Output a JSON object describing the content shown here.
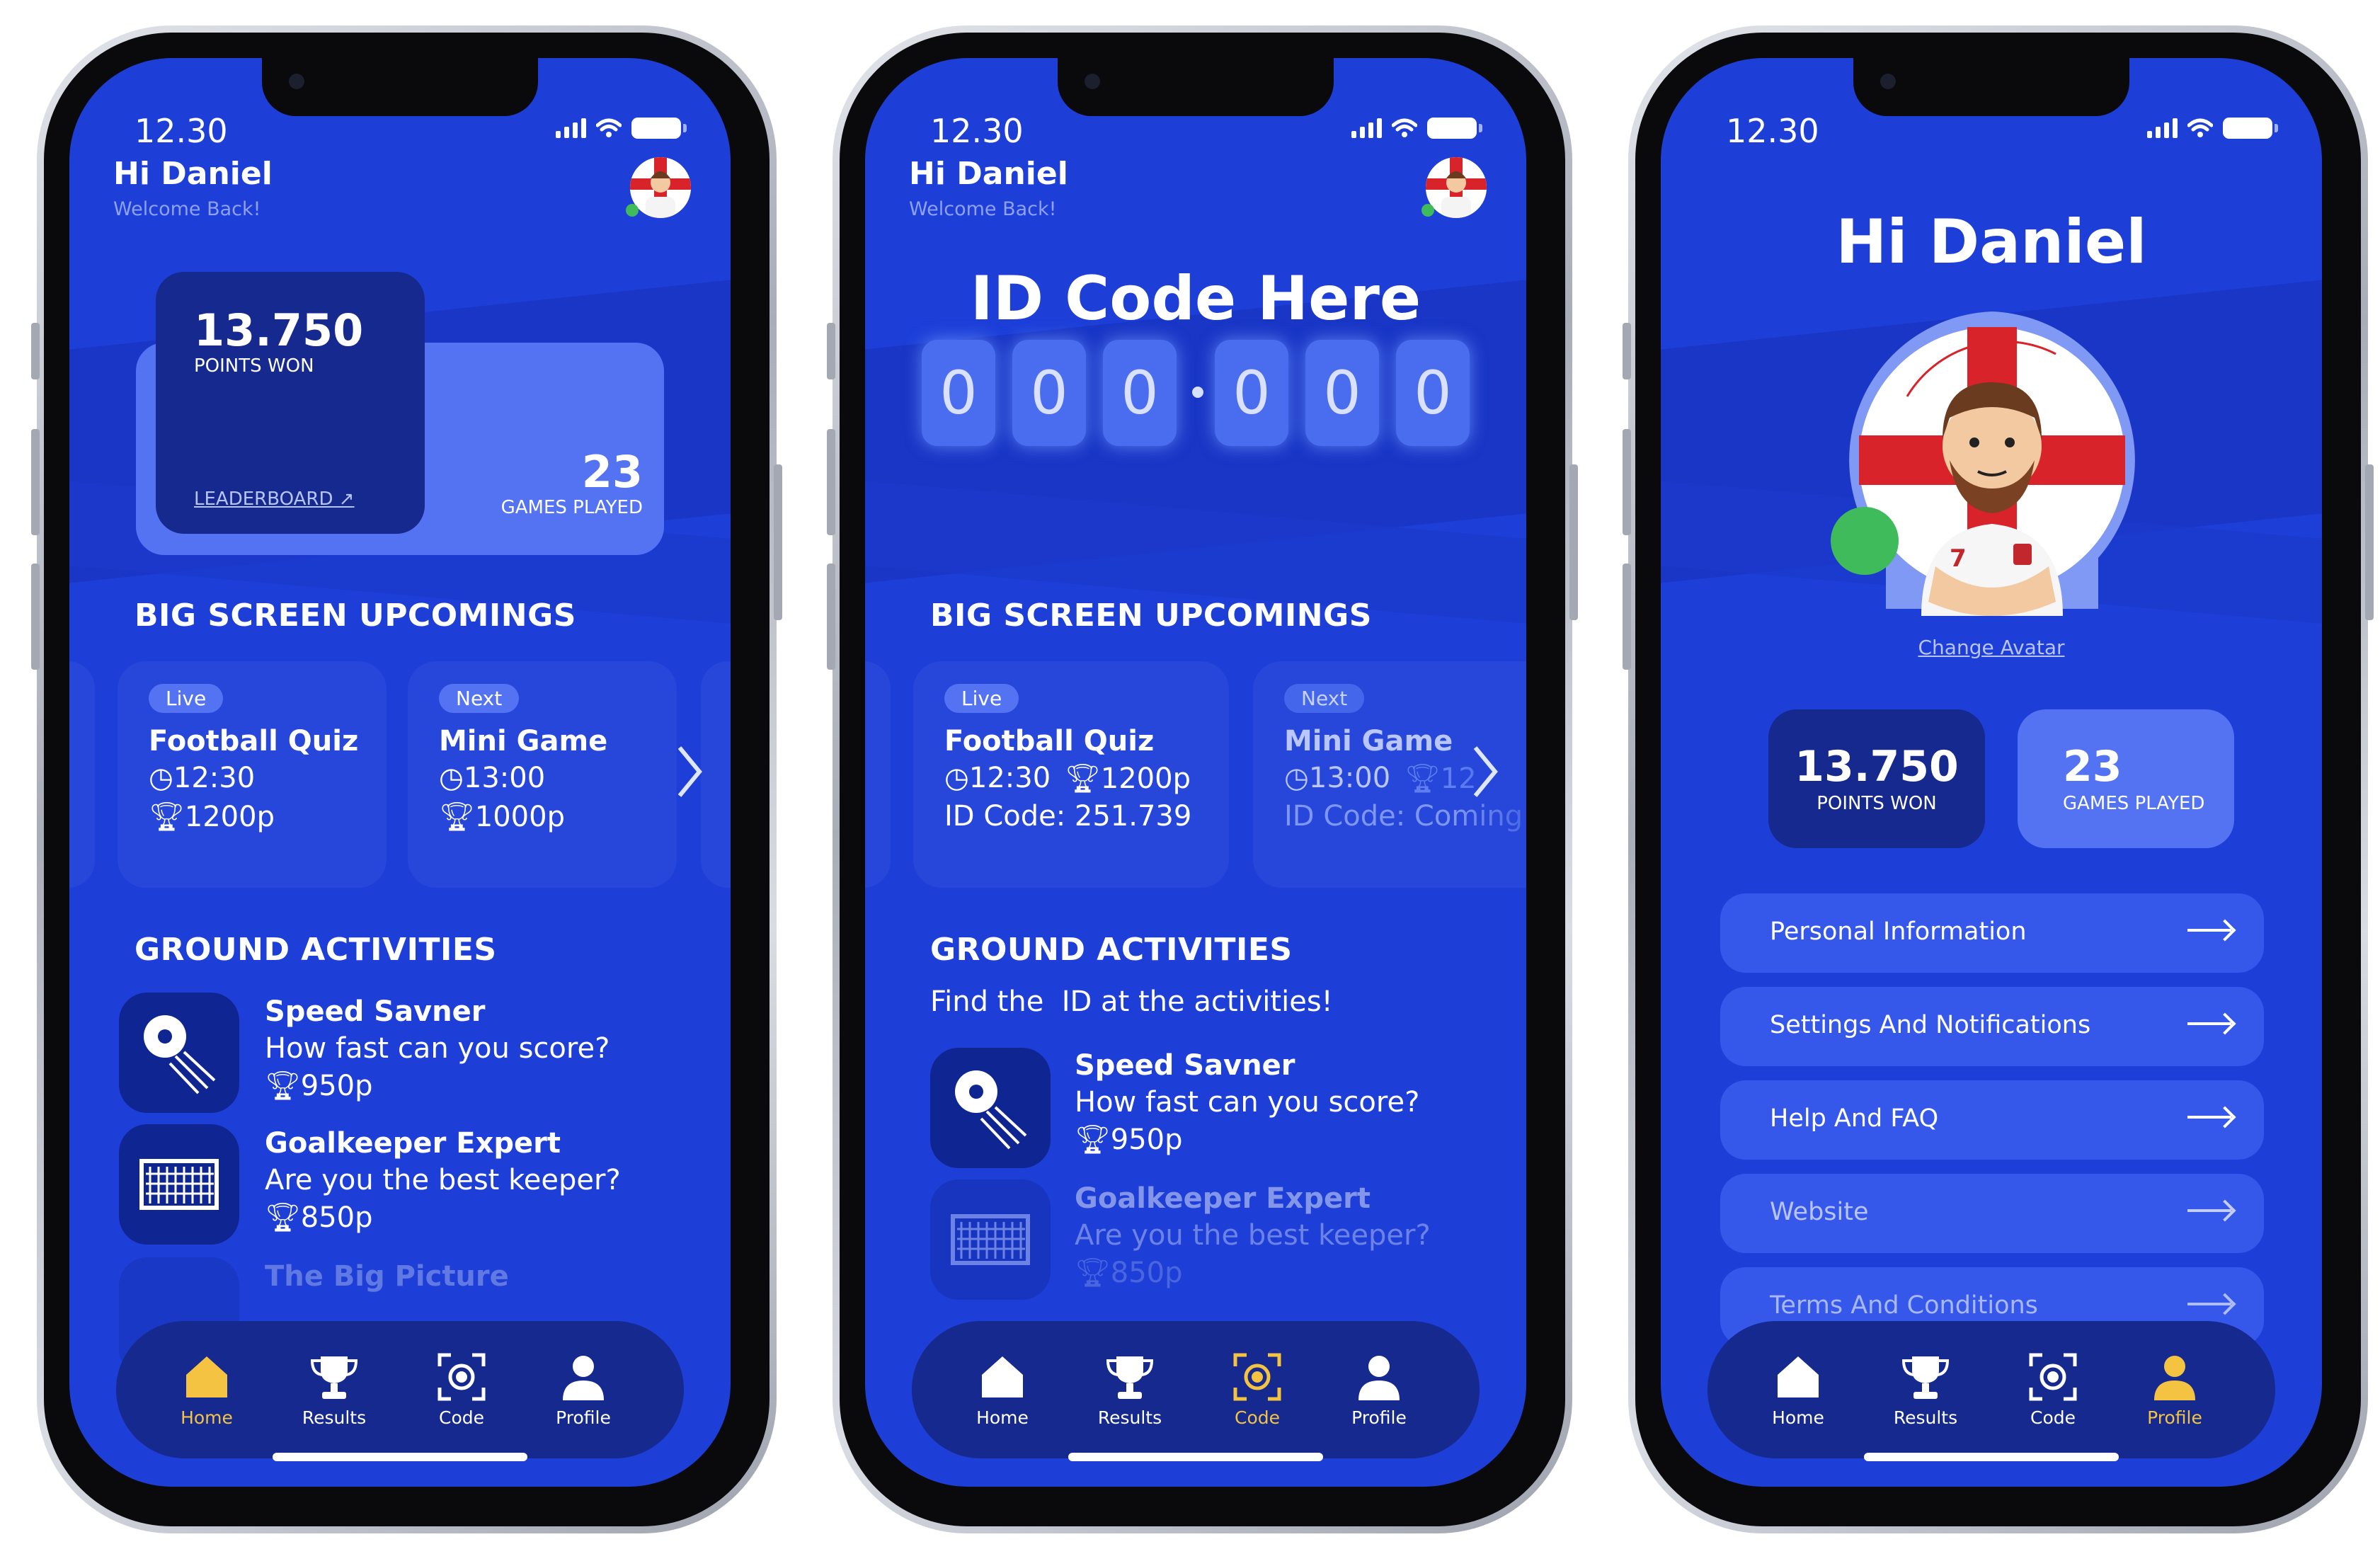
{
  "status": {
    "time": "12.30"
  },
  "screen1": {
    "greeting": "Hi Daniel",
    "welcome": "Welcome Back!",
    "points_value": "13.750",
    "points_label": "POINTS WON",
    "leaderboard": "LEADERBOARD",
    "games_value": "23",
    "games_label": "GAMES PLAYED",
    "upcomings_title": "BIG SCREEN UPCOMINGS",
    "cards": [
      {
        "tag": "Live",
        "title": "Football Quiz",
        "time": "12:30",
        "points": "1200p"
      },
      {
        "tag": "Next",
        "title": "Mini Game",
        "time": "13:00",
        "points": "1000p"
      }
    ],
    "ground_title": "GROUND ACTIVITIES",
    "activities": [
      {
        "title": "Speed Savner",
        "subtitle": "How fast can you score?",
        "points": "950p"
      },
      {
        "title": "Goalkeeper Expert",
        "subtitle": "Are you the best keeper?",
        "points": "850p"
      },
      {
        "title": "The Big Picture"
      }
    ]
  },
  "screen2": {
    "greeting": "Hi Daniel",
    "welcome": "Welcome Back!",
    "id_title": "ID Code Here",
    "digits": [
      "0",
      "0",
      "0",
      "0",
      "0",
      "0"
    ],
    "upcomings_title": "BIG SCREEN UPCOMINGS",
    "cards": [
      {
        "tag": "Live",
        "title": "Football Quiz",
        "time": "12:30",
        "points": "1200p",
        "code": "ID Code: 251.739"
      },
      {
        "tag": "Next",
        "title": "Mini Game",
        "time": "13:00",
        "points": "12",
        "code": "ID Code: Coming"
      }
    ],
    "ground_title": "GROUND ACTIVITIES",
    "find_text": "Find the  ID at the activities!",
    "activities": [
      {
        "title": "Speed Savner",
        "subtitle": "How fast can you score?",
        "points": "950p"
      },
      {
        "title": "Goalkeeper Expert",
        "subtitle": "Are you the best keeper?",
        "points": "850p"
      }
    ]
  },
  "screen3": {
    "greeting": "Hi Daniel",
    "change_avatar": "Change Avatar",
    "player_number": "7",
    "points_value": "13.750",
    "points_label": "POINTS WON",
    "games_value": "23",
    "games_label": "GAMES PLAYED",
    "menu": [
      "Personal Information",
      "Settings And Notifications",
      "Help And FAQ",
      "Website",
      "Terms And Conditions"
    ]
  },
  "nav": {
    "home": "Home",
    "results": "Results",
    "code": "Code",
    "profile": "Profile"
  },
  "colors": {
    "background": "#1d3fd8",
    "active_nav": "#f5c342",
    "nav_bg": "#15298f",
    "card_dark": "#15298f",
    "card_light": "#5473f2"
  }
}
